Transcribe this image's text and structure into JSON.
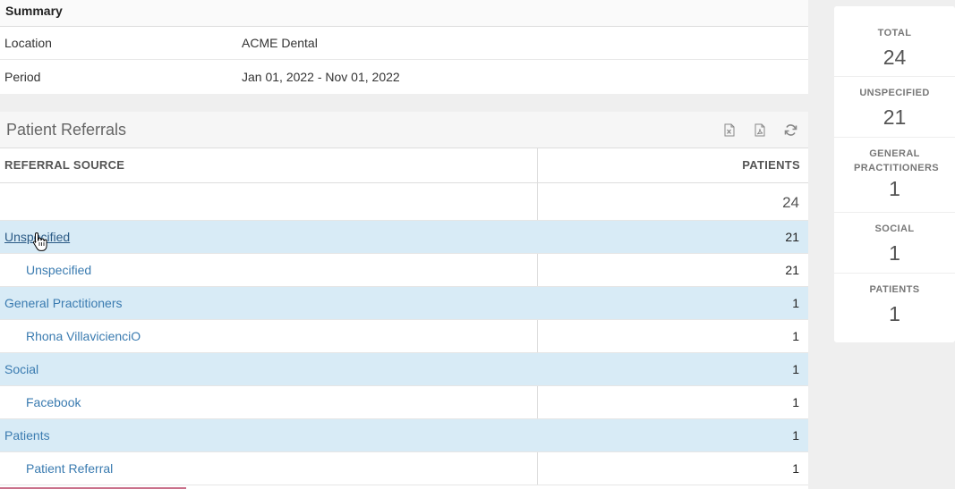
{
  "summary": {
    "title": "Summary",
    "rows": [
      {
        "label": "Location",
        "value": "ACME Dental"
      },
      {
        "label": "Period",
        "value": "Jan 01, 2022 - Nov 01, 2022"
      }
    ]
  },
  "panel": {
    "title": "Patient Referrals",
    "tools": [
      "excel-export-icon",
      "pdf-export-icon",
      "refresh-icon"
    ]
  },
  "table": {
    "headers": {
      "source": "REFERRAL SOURCE",
      "patients": "PATIENTS"
    },
    "total": "24",
    "rows": [
      {
        "type": "group",
        "name": "Unspecified",
        "count": "21"
      },
      {
        "type": "child",
        "name": "Unspecified",
        "count": "21"
      },
      {
        "type": "group",
        "name": "General Practitioners",
        "count": "1"
      },
      {
        "type": "child",
        "name": "Rhona VillavicienciO",
        "count": "1"
      },
      {
        "type": "group",
        "name": "Social",
        "count": "1"
      },
      {
        "type": "child",
        "name": "Facebook",
        "count": "1"
      },
      {
        "type": "group",
        "name": "Patients",
        "count": "1"
      },
      {
        "type": "child",
        "name": "Patient Referral",
        "count": "1"
      }
    ]
  },
  "stats": [
    {
      "label": "TOTAL",
      "value": "24"
    },
    {
      "label": "UNSPECIFIED",
      "value": "21"
    },
    {
      "label": "GENERAL PRACTITIONERS",
      "value": "1"
    },
    {
      "label": "SOCIAL",
      "value": "1"
    },
    {
      "label": "PATIENTS",
      "value": "1"
    }
  ],
  "colors": {
    "group_row_bg": "#d8ebf6",
    "link": "#3a7bb0",
    "page_bg": "#efefef"
  }
}
